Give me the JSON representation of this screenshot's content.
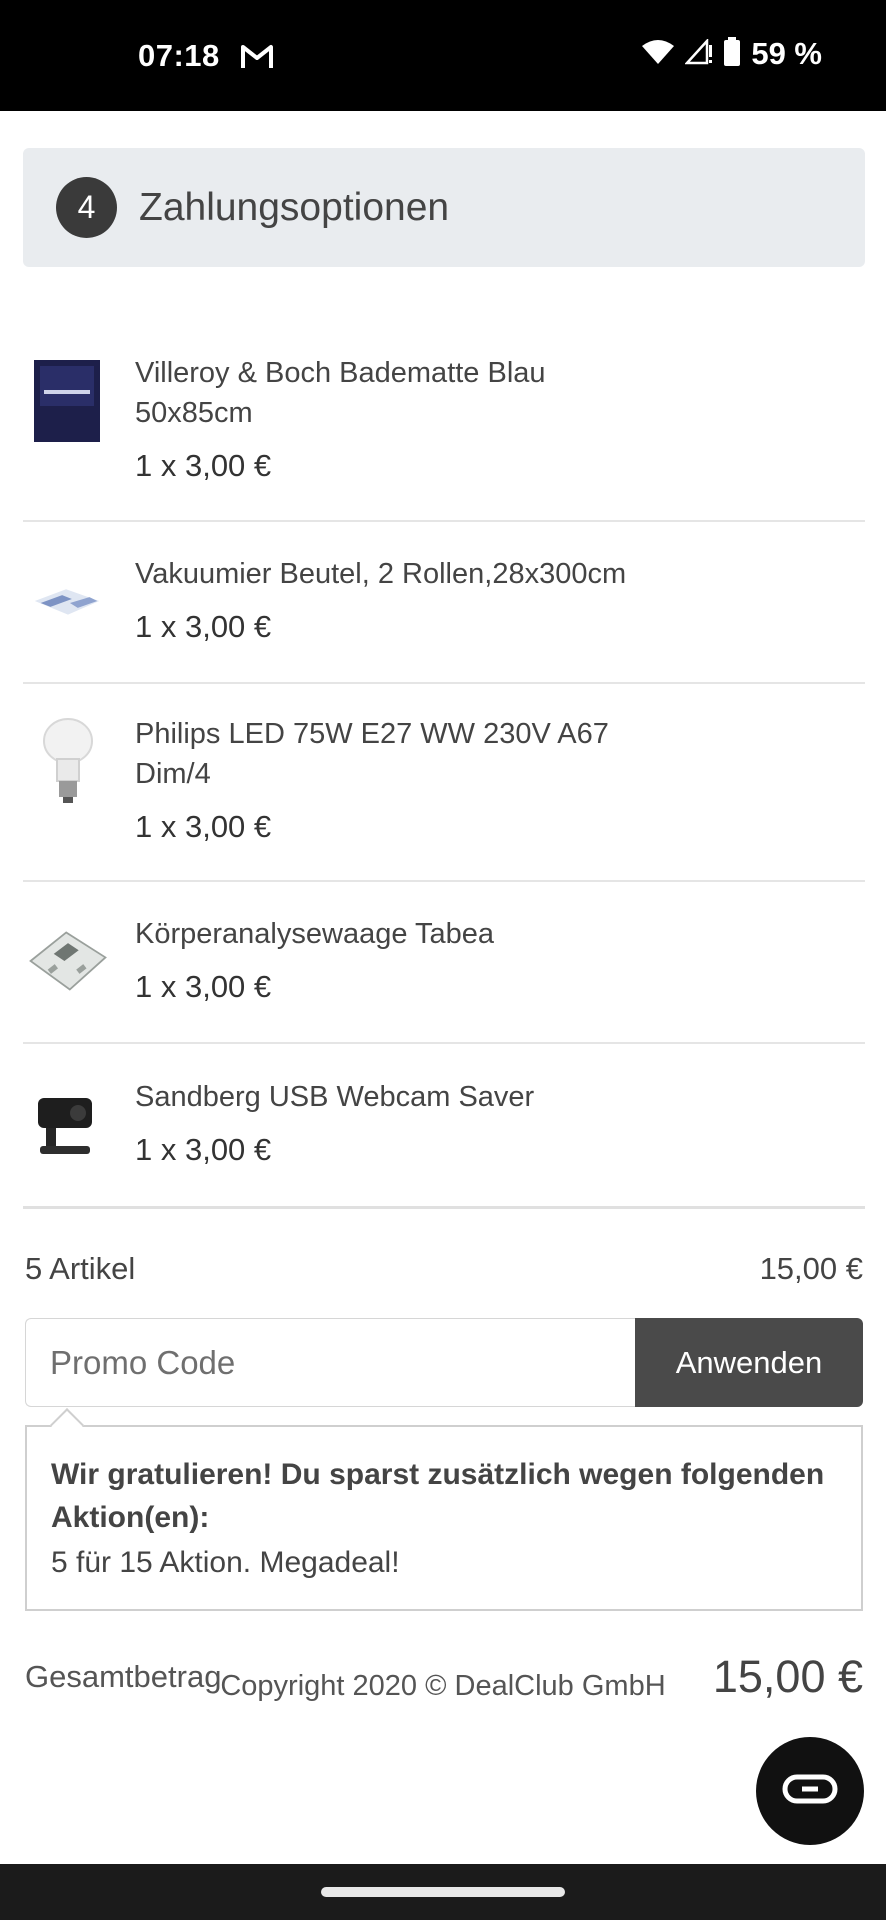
{
  "status_bar": {
    "time": "07:18",
    "notification_icon": "gmail-icon",
    "battery_text": "59 %"
  },
  "checkout": {
    "step_number": "4",
    "step_title": "Zahlungsoptionen"
  },
  "cart_items": [
    {
      "name_line1": "Villeroy & Boch Badematte Blau",
      "name_line2": "50x85cm",
      "price": "1 x 3,00 €",
      "icon": "bath-mat-thumbnail"
    },
    {
      "name_line1": "Vakuumier Beutel, 2 Rollen,28x300cm",
      "name_line2": "",
      "price": "1 x 3,00 €",
      "icon": "vacuum-bags-thumbnail"
    },
    {
      "name_line1": "Philips LED 75W E27 WW 230V A67",
      "name_line2": "Dim/4",
      "price": "1 x 3,00 €",
      "icon": "led-bulb-thumbnail"
    },
    {
      "name_line1": "Körperanalysewaage Tabea",
      "name_line2": "",
      "price": "1 x 3,00 €",
      "icon": "scale-thumbnail"
    },
    {
      "name_line1": "Sandberg USB Webcam Saver",
      "name_line2": "",
      "price": "1 x 3,00 €",
      "icon": "webcam-thumbnail"
    }
  ],
  "summary": {
    "items_label": "5 Artikel",
    "items_value": "15,00 €"
  },
  "promo": {
    "placeholder": "Promo Code",
    "button_label": "Anwenden"
  },
  "notice": {
    "title": "Wir gratulieren! Du sparst zusätzlich wegen folgenden Aktion(en):",
    "text": "5 für 15 Aktion. Megadeal!"
  },
  "total": {
    "label": "Gesamtbetrag",
    "value": "15,00 €"
  },
  "footer": {
    "copyright": "Copyright 2020 © DealClub GmbH"
  },
  "chat": {
    "icon": "chat-icon"
  }
}
